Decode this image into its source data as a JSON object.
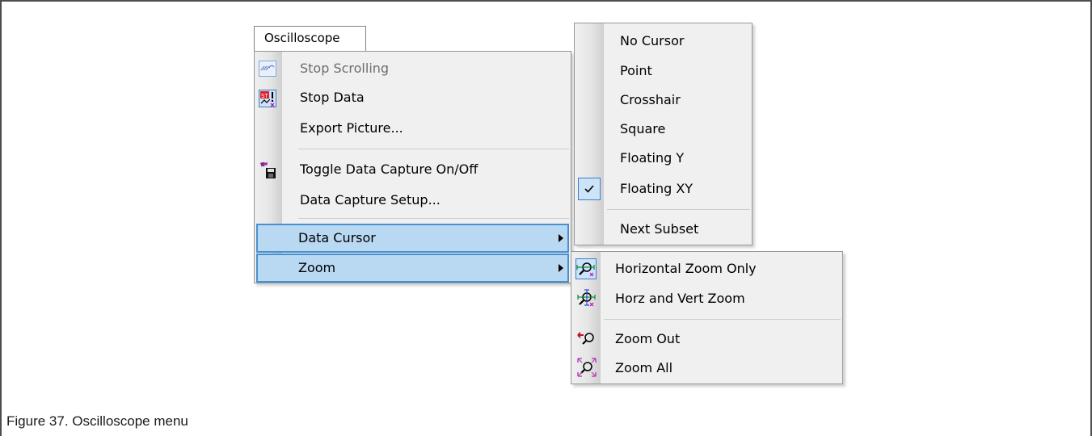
{
  "caption": "Figure 37.  Oscilloscope menu",
  "menu_bar": {
    "title": "Oscilloscope"
  },
  "main_menu": {
    "items": [
      {
        "label": "Stop Scrolling",
        "icon": "scroll-icon",
        "disabled": true
      },
      {
        "label": "Stop Data",
        "icon": "stop-data-icon"
      },
      {
        "label": "Export Picture..."
      },
      {
        "label": "Toggle Data Capture On/Off",
        "icon": "data-capture-icon"
      },
      {
        "label": "Data Capture Setup..."
      },
      {
        "label": "Data Cursor",
        "submenu": true,
        "highlighted": true
      },
      {
        "label": "Zoom",
        "submenu": true,
        "highlighted": true
      }
    ]
  },
  "cursor_menu": {
    "items": [
      {
        "label": "No Cursor"
      },
      {
        "label": "Point"
      },
      {
        "label": "Crosshair"
      },
      {
        "label": "Square"
      },
      {
        "label": "Floating Y"
      },
      {
        "label": "Floating XY",
        "checked": true
      },
      {
        "label": "Next Subset"
      }
    ]
  },
  "zoom_menu": {
    "items": [
      {
        "label": "Horizontal Zoom Only",
        "icon": "horizontal-zoom-icon",
        "checked": true
      },
      {
        "label": "Horz and Vert Zoom",
        "icon": "horz-vert-zoom-icon"
      },
      {
        "label": "Zoom Out",
        "icon": "zoom-out-icon"
      },
      {
        "label": "Zoom All",
        "icon": "zoom-all-icon"
      }
    ]
  },
  "colors": {
    "highlight": "#b9d8f2",
    "highlight_border": "#4a8fcd",
    "menu_bg": "#f0f0f0"
  }
}
